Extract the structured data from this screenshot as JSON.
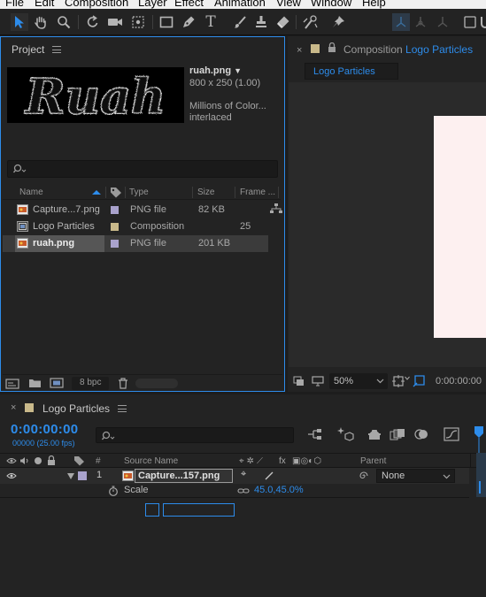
{
  "menu": [
    "File",
    "Edit",
    "Composition",
    "Layer",
    "Effect",
    "Animation",
    "View",
    "Window",
    "Help"
  ],
  "toolbar": {
    "tools": [
      "selection-tool-icon",
      "hand-tool-icon",
      "zoom-tool-icon",
      "rotate-tool-icon",
      "camera-tool-icon",
      "pan-behind-tool-icon",
      "rectangle-tool-icon",
      "pen-tool-icon",
      "type-tool-icon",
      "brush-tool-icon",
      "clone-stamp-tool-icon",
      "eraser-tool-icon",
      "roto-brush-tool-icon",
      "puppet-pin-tool-icon"
    ]
  },
  "project": {
    "tab_label": "Project",
    "thumbnail_text": "Ruah",
    "selected_name": "ruah.png",
    "selected_name_arrow": "▼",
    "dimensions": "800 x 250 (1.00)",
    "colors": "Millions of Color...",
    "interlace": "interlaced",
    "columns": {
      "name": "Name",
      "type": "Type",
      "size": "Size",
      "frame": "Frame ..."
    },
    "items": [
      {
        "name": "Capture...7.png",
        "type": "PNG file",
        "size": "82 KB",
        "frame": "",
        "swatch": "#a9a2cc",
        "icon": "png-file-icon",
        "selected": false
      },
      {
        "name": "Logo Particles",
        "type": "Composition",
        "size": "",
        "frame": "25",
        "swatch": "#c9b98a",
        "icon": "composition-icon",
        "selected": false
      },
      {
        "name": "ruah.png",
        "type": "PNG file",
        "size": "201 KB",
        "frame": "",
        "swatch": "#a9a2cc",
        "icon": "png-file-icon",
        "selected": true
      }
    ],
    "bpc": "8 bpc"
  },
  "composition": {
    "tab_prefix": "Composition",
    "tab_name": "Logo Particles",
    "subtab": "Logo Particles",
    "zoom": "50%",
    "timecode": "0:00:00:00"
  },
  "timeline": {
    "tab_label": "Logo Particles",
    "timecode": "0:00:00:00",
    "fps": "00000 (25.00 fps)",
    "headers": {
      "num": "#",
      "source": "Source Name",
      "parent": "Parent"
    },
    "layer": {
      "number": "1",
      "name": "Capture...157.png",
      "parent": "None"
    },
    "property": {
      "name": "Scale",
      "value": "45.0,45.0%"
    }
  },
  "colors": {
    "accent": "#2d8ceb",
    "panel": "#232323",
    "canvas": "#fdf0f0"
  }
}
